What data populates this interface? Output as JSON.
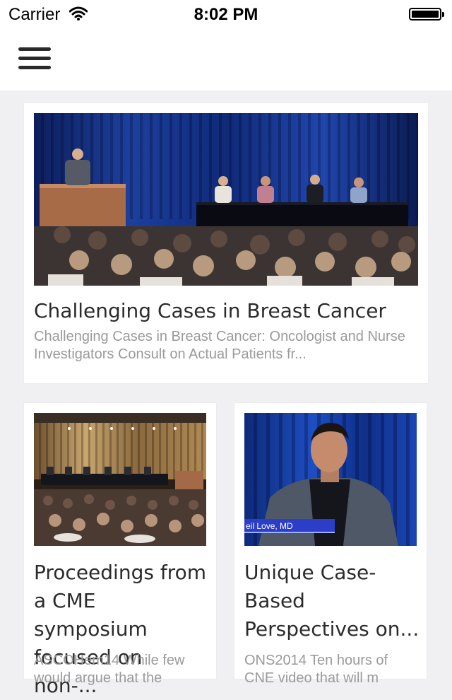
{
  "status_bar": {
    "carrier": "Carrier",
    "time": "8:02 PM"
  },
  "nav": {
    "menu_icon": "hamburger-menu-icon"
  },
  "cards": [
    {
      "title": "Challenging Cases in Breast Cancer",
      "description": "Challenging Cases in Breast Cancer: Oncologist and Nurse Investigators Consult on Actual Patients fr...",
      "image": "conference-panel-photo"
    },
    {
      "title": "Proceedings from a CME symposium focused on non-...",
      "description": "ASCOHem14 While few would argue that the",
      "image": "symposium-hall-photo"
    },
    {
      "title": "Unique Case-Based Perspectives on...",
      "description": "ONS2014 Ten hours of CNE video that will m",
      "image": "speaker-portrait-photo",
      "caption": "eil Love, MD"
    }
  ],
  "colors": {
    "background": "#f0f0f2",
    "card": "#ffffff",
    "title": "#2b2b2b",
    "description": "#9a9a9a",
    "stage_blue": "#1b3a8c",
    "caption_bar": "#2c3ec8"
  }
}
